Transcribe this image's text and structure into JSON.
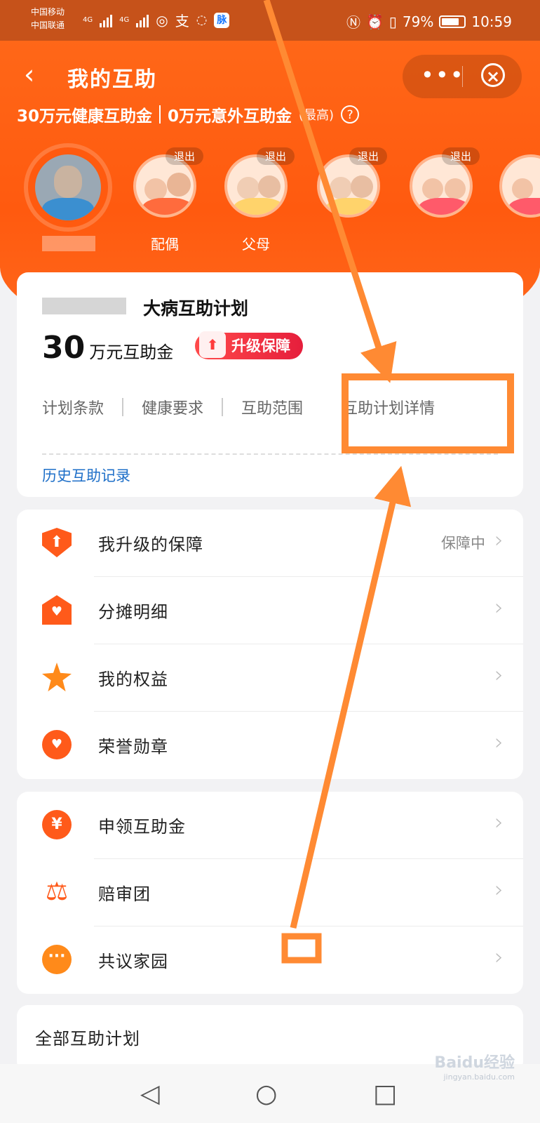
{
  "status_bar": {
    "carrier_1": "中国移动",
    "carrier_2": "中国联通",
    "network_1": "4G",
    "network_2": "4G",
    "app_badge": "脉",
    "battery": "79%",
    "time": "10:59"
  },
  "nav": {
    "title": "我的互助"
  },
  "summary": {
    "health_amount": "30万元健康互助金",
    "accident_amount": "0万元意外互助金",
    "note": "(最高)"
  },
  "members": [
    {
      "name": "",
      "exit": ""
    },
    {
      "name": "配偶",
      "exit": "退出"
    },
    {
      "name": "父母",
      "exit": "退出"
    },
    {
      "name": "",
      "exit": "退出"
    },
    {
      "name": "",
      "exit": "退出"
    }
  ],
  "plan": {
    "name": "大病互助计划",
    "amount": "30",
    "amount_unit": "万元互助金",
    "upgrade_label": "升级保障",
    "tabs": [
      "计划条款",
      "健康要求",
      "互助范围",
      "互助计划详情"
    ],
    "history_link": "历史互助记录"
  },
  "list_1": [
    {
      "label": "我升级的保障",
      "status": "保障中",
      "icon": "shield-up-icon"
    },
    {
      "label": "分摊明细",
      "status": "",
      "icon": "house-heart-icon"
    },
    {
      "label": "我的权益",
      "status": "",
      "icon": "star-icon"
    },
    {
      "label": "荣誉勋章",
      "status": "",
      "icon": "medal-icon"
    }
  ],
  "list_2": [
    {
      "label": "申领互助金",
      "icon": "yen-icon"
    },
    {
      "label": "赔审团",
      "icon": "scale-icon"
    },
    {
      "label": "共议家园",
      "icon": "chat-icon"
    }
  ],
  "all_plans": "全部互助计划",
  "watermark": "Baidu经验",
  "watermark_sub": "jingyan.baidu.com",
  "colors": {
    "accent": "#ff5a0f",
    "annotation": "#ff8a33",
    "link": "#1e6fc8"
  }
}
